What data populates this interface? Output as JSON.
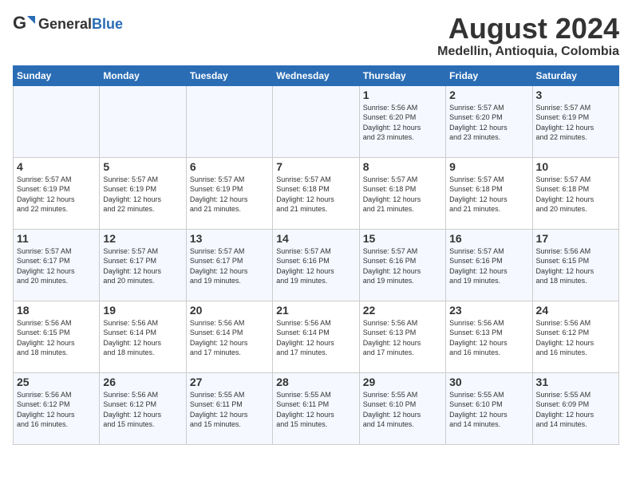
{
  "logo": {
    "general": "General",
    "blue": "Blue"
  },
  "header": {
    "title": "August 2024",
    "subtitle": "Medellin, Antioquia, Colombia"
  },
  "days": [
    "Sunday",
    "Monday",
    "Tuesday",
    "Wednesday",
    "Thursday",
    "Friday",
    "Saturday"
  ],
  "weeks": [
    [
      {
        "day": "",
        "info": ""
      },
      {
        "day": "",
        "info": ""
      },
      {
        "day": "",
        "info": ""
      },
      {
        "day": "",
        "info": ""
      },
      {
        "day": "1",
        "info": "Sunrise: 5:56 AM\nSunset: 6:20 PM\nDaylight: 12 hours\nand 23 minutes."
      },
      {
        "day": "2",
        "info": "Sunrise: 5:57 AM\nSunset: 6:20 PM\nDaylight: 12 hours\nand 23 minutes."
      },
      {
        "day": "3",
        "info": "Sunrise: 5:57 AM\nSunset: 6:19 PM\nDaylight: 12 hours\nand 22 minutes."
      }
    ],
    [
      {
        "day": "4",
        "info": "Sunrise: 5:57 AM\nSunset: 6:19 PM\nDaylight: 12 hours\nand 22 minutes."
      },
      {
        "day": "5",
        "info": "Sunrise: 5:57 AM\nSunset: 6:19 PM\nDaylight: 12 hours\nand 22 minutes."
      },
      {
        "day": "6",
        "info": "Sunrise: 5:57 AM\nSunset: 6:19 PM\nDaylight: 12 hours\nand 21 minutes."
      },
      {
        "day": "7",
        "info": "Sunrise: 5:57 AM\nSunset: 6:18 PM\nDaylight: 12 hours\nand 21 minutes."
      },
      {
        "day": "8",
        "info": "Sunrise: 5:57 AM\nSunset: 6:18 PM\nDaylight: 12 hours\nand 21 minutes."
      },
      {
        "day": "9",
        "info": "Sunrise: 5:57 AM\nSunset: 6:18 PM\nDaylight: 12 hours\nand 21 minutes."
      },
      {
        "day": "10",
        "info": "Sunrise: 5:57 AM\nSunset: 6:18 PM\nDaylight: 12 hours\nand 20 minutes."
      }
    ],
    [
      {
        "day": "11",
        "info": "Sunrise: 5:57 AM\nSunset: 6:17 PM\nDaylight: 12 hours\nand 20 minutes."
      },
      {
        "day": "12",
        "info": "Sunrise: 5:57 AM\nSunset: 6:17 PM\nDaylight: 12 hours\nand 20 minutes."
      },
      {
        "day": "13",
        "info": "Sunrise: 5:57 AM\nSunset: 6:17 PM\nDaylight: 12 hours\nand 19 minutes."
      },
      {
        "day": "14",
        "info": "Sunrise: 5:57 AM\nSunset: 6:16 PM\nDaylight: 12 hours\nand 19 minutes."
      },
      {
        "day": "15",
        "info": "Sunrise: 5:57 AM\nSunset: 6:16 PM\nDaylight: 12 hours\nand 19 minutes."
      },
      {
        "day": "16",
        "info": "Sunrise: 5:57 AM\nSunset: 6:16 PM\nDaylight: 12 hours\nand 19 minutes."
      },
      {
        "day": "17",
        "info": "Sunrise: 5:56 AM\nSunset: 6:15 PM\nDaylight: 12 hours\nand 18 minutes."
      }
    ],
    [
      {
        "day": "18",
        "info": "Sunrise: 5:56 AM\nSunset: 6:15 PM\nDaylight: 12 hours\nand 18 minutes."
      },
      {
        "day": "19",
        "info": "Sunrise: 5:56 AM\nSunset: 6:14 PM\nDaylight: 12 hours\nand 18 minutes."
      },
      {
        "day": "20",
        "info": "Sunrise: 5:56 AM\nSunset: 6:14 PM\nDaylight: 12 hours\nand 17 minutes."
      },
      {
        "day": "21",
        "info": "Sunrise: 5:56 AM\nSunset: 6:14 PM\nDaylight: 12 hours\nand 17 minutes."
      },
      {
        "day": "22",
        "info": "Sunrise: 5:56 AM\nSunset: 6:13 PM\nDaylight: 12 hours\nand 17 minutes."
      },
      {
        "day": "23",
        "info": "Sunrise: 5:56 AM\nSunset: 6:13 PM\nDaylight: 12 hours\nand 16 minutes."
      },
      {
        "day": "24",
        "info": "Sunrise: 5:56 AM\nSunset: 6:12 PM\nDaylight: 12 hours\nand 16 minutes."
      }
    ],
    [
      {
        "day": "25",
        "info": "Sunrise: 5:56 AM\nSunset: 6:12 PM\nDaylight: 12 hours\nand 16 minutes."
      },
      {
        "day": "26",
        "info": "Sunrise: 5:56 AM\nSunset: 6:12 PM\nDaylight: 12 hours\nand 15 minutes."
      },
      {
        "day": "27",
        "info": "Sunrise: 5:55 AM\nSunset: 6:11 PM\nDaylight: 12 hours\nand 15 minutes."
      },
      {
        "day": "28",
        "info": "Sunrise: 5:55 AM\nSunset: 6:11 PM\nDaylight: 12 hours\nand 15 minutes."
      },
      {
        "day": "29",
        "info": "Sunrise: 5:55 AM\nSunset: 6:10 PM\nDaylight: 12 hours\nand 14 minutes."
      },
      {
        "day": "30",
        "info": "Sunrise: 5:55 AM\nSunset: 6:10 PM\nDaylight: 12 hours\nand 14 minutes."
      },
      {
        "day": "31",
        "info": "Sunrise: 5:55 AM\nSunset: 6:09 PM\nDaylight: 12 hours\nand 14 minutes."
      }
    ]
  ]
}
